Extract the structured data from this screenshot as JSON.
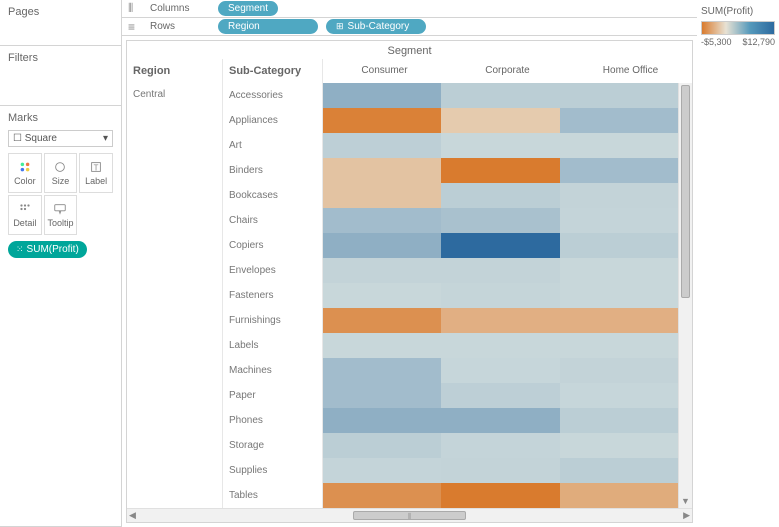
{
  "panels": {
    "pages": "Pages",
    "filters": "Filters",
    "marks": "Marks"
  },
  "marks": {
    "shape": "Square",
    "buttons": {
      "color": "Color",
      "size": "Size",
      "label": "Label",
      "detail": "Detail",
      "tooltip": "Tooltip"
    },
    "pill": "SUM(Profit)"
  },
  "shelves": {
    "columns": {
      "label": "Columns",
      "pills": [
        "Segment"
      ]
    },
    "rows": {
      "label": "Rows",
      "pills": [
        "Region",
        "Sub-Category"
      ]
    }
  },
  "viz": {
    "fieldHeader": "Segment",
    "rowHeaders": {
      "region": "Region",
      "sub": "Sub-Category"
    },
    "columns": [
      "Consumer",
      "Corporate",
      "Home Office"
    ],
    "region": "Central",
    "subcats": [
      "Accessories",
      "Appliances",
      "Art",
      "Binders",
      "Bookcases",
      "Chairs",
      "Copiers",
      "Envelopes",
      "Fasteners",
      "Furnishings",
      "Labels",
      "Machines",
      "Paper",
      "Phones",
      "Storage",
      "Supplies",
      "Tables"
    ]
  },
  "legend": {
    "title": "SUM(Profit)",
    "min": "-$5,300",
    "max": "$12,790"
  },
  "chart_data": {
    "type": "heatmap",
    "title": "Segment",
    "xlabel": "Segment",
    "ylabel": "Region / Sub-Category",
    "x": [
      "Consumer",
      "Corporate",
      "Home Office"
    ],
    "y_region": "Central",
    "y": [
      "Accessories",
      "Appliances",
      "Art",
      "Binders",
      "Bookcases",
      "Chairs",
      "Copiers",
      "Envelopes",
      "Fasteners",
      "Furnishings",
      "Labels",
      "Machines",
      "Paper",
      "Phones",
      "Storage",
      "Supplies",
      "Tables"
    ],
    "color_field": "SUM(Profit)",
    "color_range": [
      -5300,
      12790
    ],
    "values": [
      [
        5200,
        1800,
        1800
      ],
      [
        -5000,
        -1200,
        3700
      ],
      [
        1600,
        800,
        800
      ],
      [
        -1600,
        -5300,
        3700
      ],
      [
        -1600,
        1800,
        1200
      ],
      [
        3700,
        3200,
        1100
      ],
      [
        5200,
        12790,
        1800
      ],
      [
        1200,
        1200,
        800
      ],
      [
        800,
        1000,
        800
      ],
      [
        -4200,
        -2600,
        -2600
      ],
      [
        800,
        800,
        800
      ],
      [
        3700,
        900,
        1200
      ],
      [
        3700,
        1600,
        900
      ],
      [
        5200,
        5200,
        1800
      ],
      [
        1800,
        1100,
        800
      ],
      [
        1100,
        1200,
        1800
      ],
      [
        -4200,
        -5300,
        -2800
      ]
    ]
  }
}
